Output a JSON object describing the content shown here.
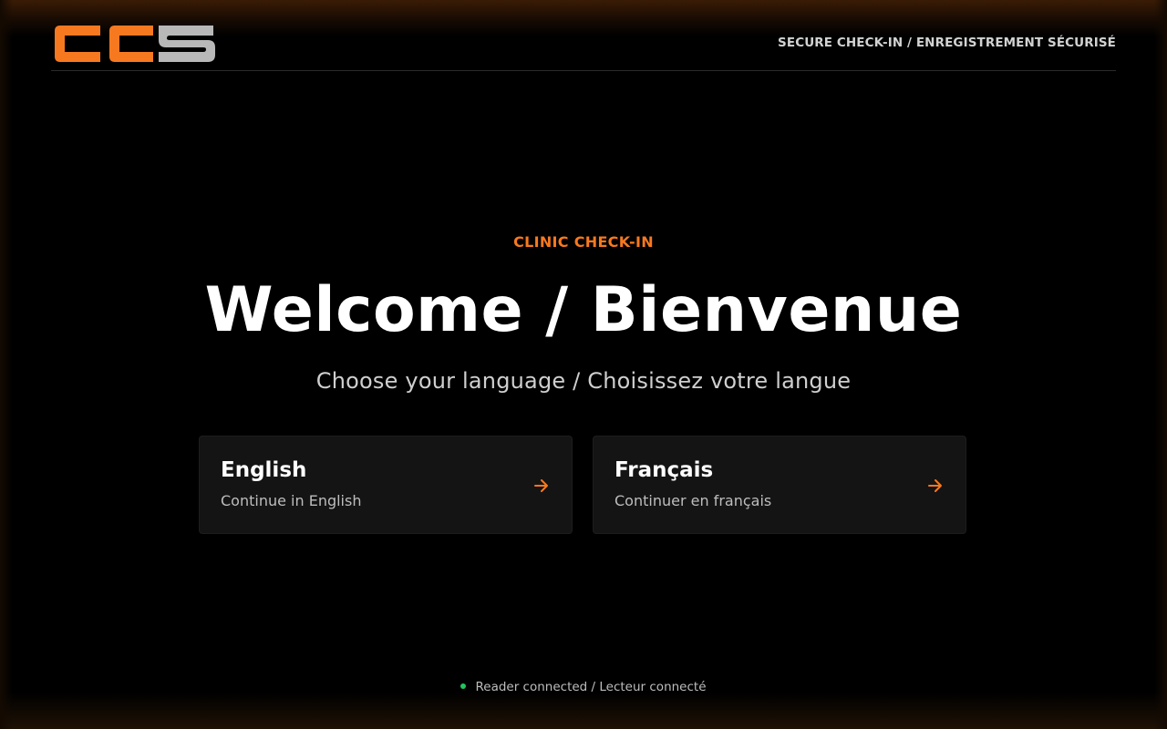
{
  "brand": {
    "logo_text": "CCS",
    "colors": {
      "accent": "#f7791f",
      "logo_gray": "#b8b8b8",
      "status_ok": "#22c55e"
    }
  },
  "header": {
    "tagline": "SECURE CHECK-IN / ENREGISTREMENT SÉCURISÉ"
  },
  "main": {
    "eyebrow": "CLINIC CHECK-IN",
    "title": "Welcome / Bienvenue",
    "subtitle": "Choose your language / Choisissez votre langue",
    "languages": [
      {
        "name": "English",
        "description": "Continue in English",
        "icon": "arrow-right-icon"
      },
      {
        "name": "Français",
        "description": "Continuer en français",
        "icon": "arrow-right-icon"
      }
    ]
  },
  "footer": {
    "status_text": "Reader connected / Lecteur connecté"
  }
}
